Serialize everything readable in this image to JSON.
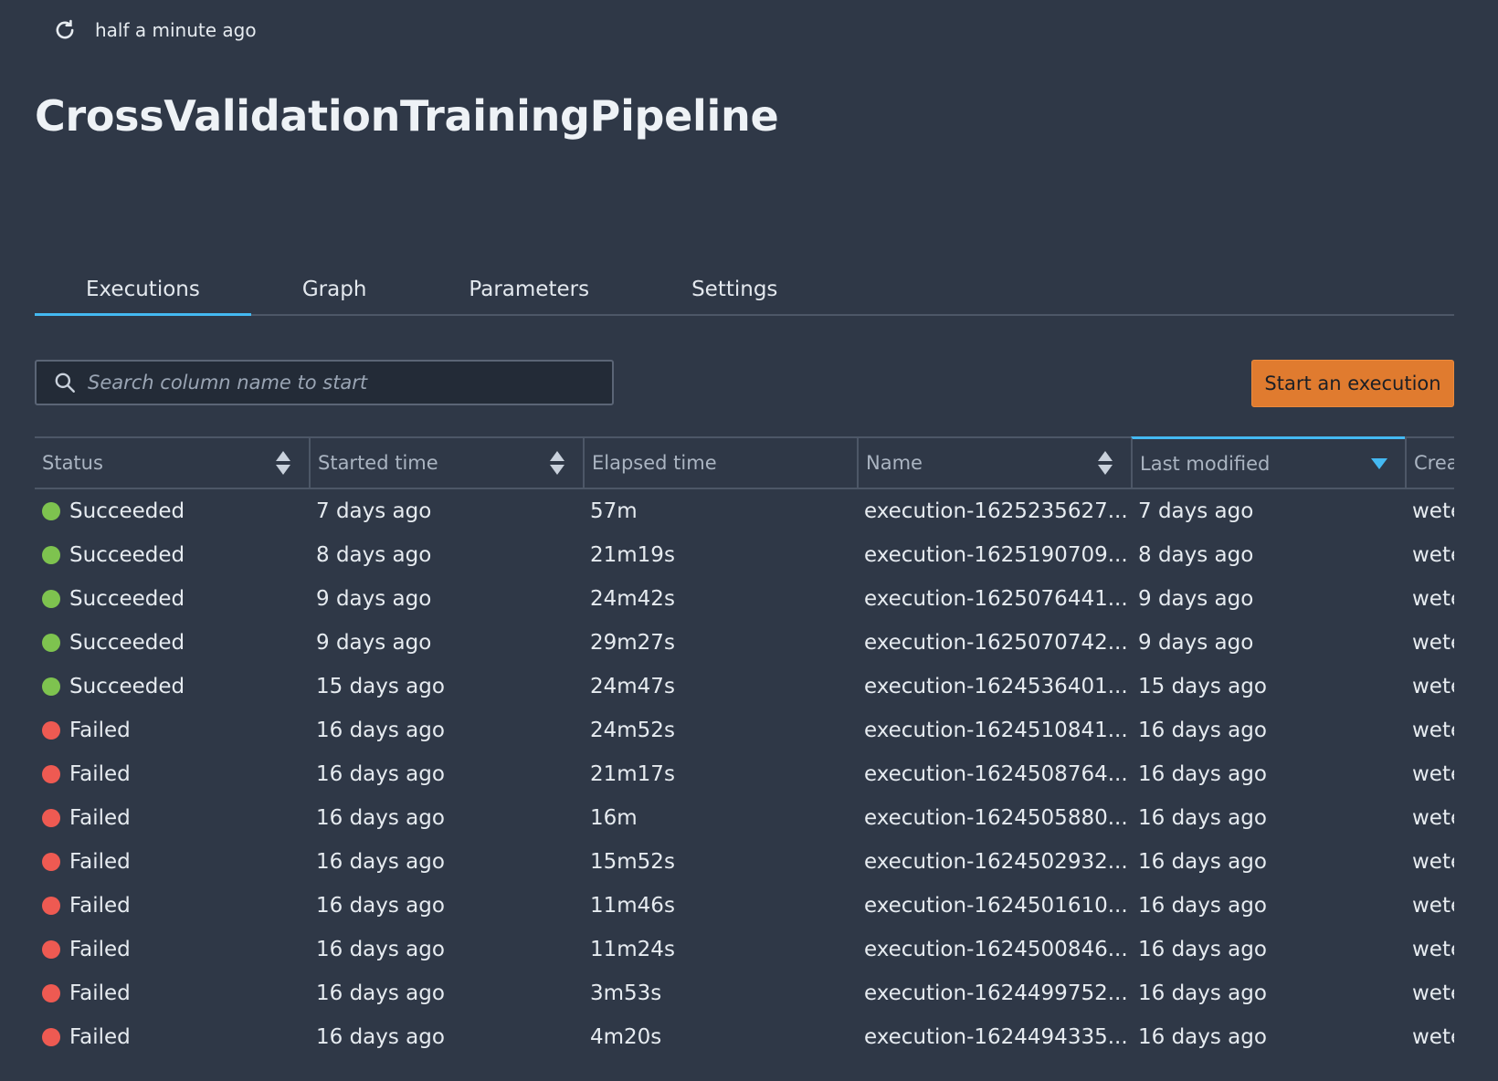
{
  "header": {
    "refresh_text": "half a minute ago",
    "title": "CrossValidationTrainingPipeline"
  },
  "tabs": [
    {
      "label": "Executions",
      "active": true
    },
    {
      "label": "Graph",
      "active": false
    },
    {
      "label": "Parameters",
      "active": false
    },
    {
      "label": "Settings",
      "active": false
    }
  ],
  "search": {
    "placeholder": "Search column name to start"
  },
  "actions": {
    "start_label": "Start an execution"
  },
  "colors": {
    "accent": "#44b9f2",
    "button": "#e07b2f",
    "succeeded": "#7ec34f",
    "failed": "#ee5a52"
  },
  "table": {
    "columns": [
      {
        "label": "Status",
        "sort": "both"
      },
      {
        "label": "Started time",
        "sort": "both"
      },
      {
        "label": "Elapsed time",
        "sort": "none"
      },
      {
        "label": "Name",
        "sort": "both"
      },
      {
        "label": "Last modified",
        "sort": "desc"
      },
      {
        "label": "Crea",
        "sort": "none"
      }
    ],
    "rows": [
      {
        "status": "Succeeded",
        "started": "7 days ago",
        "elapsed": "57m",
        "name": "execution-1625235627...",
        "modified": "7 days ago",
        "created": "wete"
      },
      {
        "status": "Succeeded",
        "started": "8 days ago",
        "elapsed": "21m19s",
        "name": "execution-1625190709...",
        "modified": "8 days ago",
        "created": "wete"
      },
      {
        "status": "Succeeded",
        "started": "9 days ago",
        "elapsed": "24m42s",
        "name": "execution-1625076441...",
        "modified": "9 days ago",
        "created": "wete"
      },
      {
        "status": "Succeeded",
        "started": "9 days ago",
        "elapsed": "29m27s",
        "name": "execution-1625070742...",
        "modified": "9 days ago",
        "created": "wete"
      },
      {
        "status": "Succeeded",
        "started": "15 days ago",
        "elapsed": "24m47s",
        "name": "execution-1624536401...",
        "modified": "15 days ago",
        "created": "wete"
      },
      {
        "status": "Failed",
        "started": "16 days ago",
        "elapsed": "24m52s",
        "name": "execution-1624510841...",
        "modified": "16 days ago",
        "created": "wete"
      },
      {
        "status": "Failed",
        "started": "16 days ago",
        "elapsed": "21m17s",
        "name": "execution-1624508764...",
        "modified": "16 days ago",
        "created": "wete"
      },
      {
        "status": "Failed",
        "started": "16 days ago",
        "elapsed": "16m",
        "name": "execution-1624505880...",
        "modified": "16 days ago",
        "created": "wete"
      },
      {
        "status": "Failed",
        "started": "16 days ago",
        "elapsed": "15m52s",
        "name": "execution-1624502932...",
        "modified": "16 days ago",
        "created": "wete"
      },
      {
        "status": "Failed",
        "started": "16 days ago",
        "elapsed": "11m46s",
        "name": "execution-1624501610...",
        "modified": "16 days ago",
        "created": "wete"
      },
      {
        "status": "Failed",
        "started": "16 days ago",
        "elapsed": "11m24s",
        "name": "execution-1624500846...",
        "modified": "16 days ago",
        "created": "wete"
      },
      {
        "status": "Failed",
        "started": "16 days ago",
        "elapsed": "3m53s",
        "name": "execution-1624499752...",
        "modified": "16 days ago",
        "created": "wete"
      },
      {
        "status": "Failed",
        "started": "16 days ago",
        "elapsed": "4m20s",
        "name": "execution-1624494335...",
        "modified": "16 days ago",
        "created": "wete"
      }
    ]
  }
}
